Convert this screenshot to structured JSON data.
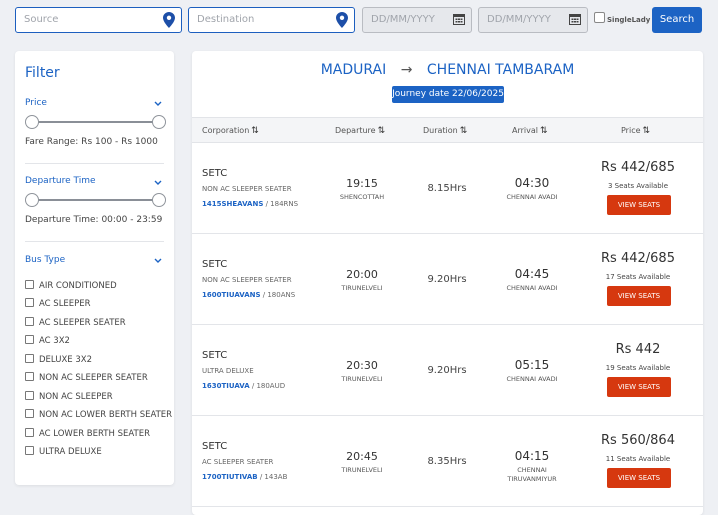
{
  "search": {
    "source_placeholder": "Source",
    "destination_placeholder": "Destination",
    "date1_placeholder": "DD/MM/YYYY",
    "date2_placeholder": "DD/MM/YYYY",
    "single_lady_label": "SingleLady",
    "search_label": "Search"
  },
  "filter": {
    "title": "Filter",
    "price": {
      "title": "Price",
      "range_text": "Fare Range: Rs 100 - Rs 1000"
    },
    "departure": {
      "title": "Departure Time",
      "range_text": "Departure Time: 00:00 - 23:59"
    },
    "bus_type": {
      "title": "Bus Type",
      "options": [
        "AIR CONDITIONED",
        "AC SLEEPER",
        "AC SLEEPER SEATER",
        "AC 3X2",
        "DELUXE 3X2",
        "NON AC SLEEPER SEATER",
        "NON AC SLEEPER",
        "NON AC LOWER BERTH SEATER",
        "AC LOWER BERTH SEATER",
        "ULTRA DELUXE"
      ]
    }
  },
  "route": {
    "from": "MADURAI",
    "arrow": "→",
    "to": "CHENNAI TAMBARAM",
    "journey_date": "Journey date 22/06/2025"
  },
  "table": {
    "headers": {
      "corporation": "Corporation",
      "departure": "Departure",
      "duration": "Duration",
      "arrival": "Arrival",
      "price": "Price"
    },
    "view_label": "VIEW SEATS",
    "rows": [
      {
        "corp": "SETC",
        "type": "NON AC SLEEPER SEATER",
        "code": "1415SHEAVANS",
        "code_suffix": " / 184RNS",
        "dep_time": "19:15",
        "dep_place": "SHENCOTTAH",
        "duration": "8.15Hrs",
        "arr_time": "04:30",
        "arr_place": "CHENNAI AVADI",
        "price": "Rs 442/685",
        "seats": "3 Seats Available"
      },
      {
        "corp": "SETC",
        "type": "NON AC SLEEPER SEATER",
        "code": "1600TIUAVANS",
        "code_suffix": " / 180ANS",
        "dep_time": "20:00",
        "dep_place": "TIRUNELVELI",
        "duration": "9.20Hrs",
        "arr_time": "04:45",
        "arr_place": "CHENNAI AVADI",
        "price": "Rs 442/685",
        "seats": "17 Seats Available"
      },
      {
        "corp": "SETC",
        "type": "ULTRA DELUXE",
        "code": "1630TIUAVA",
        "code_suffix": " / 180AUD",
        "dep_time": "20:30",
        "dep_place": "TIRUNELVELI",
        "duration": "9.20Hrs",
        "arr_time": "05:15",
        "arr_place": "CHENNAI AVADI",
        "price": "Rs 442",
        "seats": "19 Seats Available"
      },
      {
        "corp": "SETC",
        "type": "AC SLEEPER SEATER",
        "code": "1700TIUTIVAB",
        "code_suffix": " / 143AB",
        "dep_time": "20:45",
        "dep_place": "TIRUNELVELI",
        "duration": "8.35Hrs",
        "arr_time": "04:15",
        "arr_place": "CHENNAI TIRUVANMIYUR",
        "price": "Rs 560/864",
        "seats": "11 Seats Available"
      }
    ]
  },
  "colors": {
    "accent": "#1c63c4",
    "view_button": "#d6380f"
  }
}
